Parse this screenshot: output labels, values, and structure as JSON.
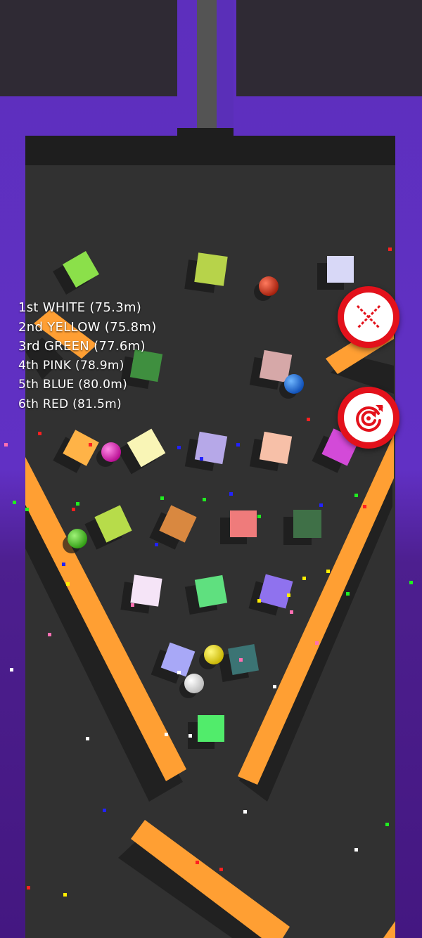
{
  "leaderboard": [
    {
      "text": "1st WHITE (75.3m)"
    },
    {
      "text": "2nd YELLOW (75.8m)"
    },
    {
      "text": "3rd GREEN (77.6m)"
    },
    {
      "text": "4th PINK (78.9m)"
    },
    {
      "text": "5th BLUE (80.0m)"
    },
    {
      "text": "6th RED (81.5m)"
    }
  ],
  "buttons": {
    "close": {
      "icon": "close-x-icon"
    },
    "restart": {
      "icon": "restart-arrows-icon"
    }
  },
  "colors": {
    "wall": "#5a2fb8",
    "floor": "#313131",
    "rail": "#ff9f33",
    "button_red": "#e3111b"
  },
  "balls": [
    {
      "color": "white",
      "hex": "#f2f2f2"
    },
    {
      "color": "yellow",
      "hex": "#f2e21a"
    },
    {
      "color": "green",
      "hex": "#46d11f"
    },
    {
      "color": "pink",
      "hex": "#e51fb9"
    },
    {
      "color": "blue",
      "hex": "#1e6fe0"
    },
    {
      "color": "red",
      "hex": "#d8321a"
    }
  ]
}
